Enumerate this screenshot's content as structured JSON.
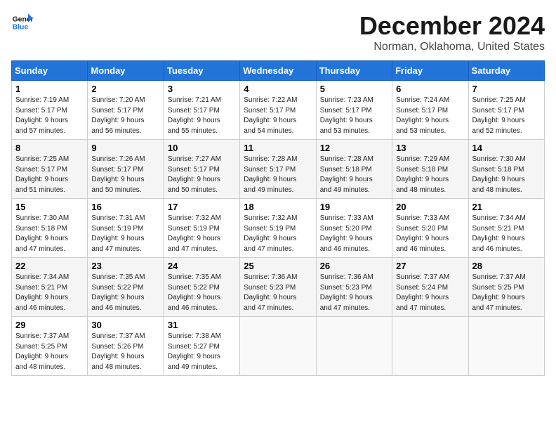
{
  "header": {
    "logo_line1": "General",
    "logo_line2": "Blue",
    "title": "December 2024",
    "subtitle": "Norman, Oklahoma, United States"
  },
  "days_of_week": [
    "Sunday",
    "Monday",
    "Tuesday",
    "Wednesday",
    "Thursday",
    "Friday",
    "Saturday"
  ],
  "weeks": [
    [
      {
        "day": 1,
        "sunrise": "7:19 AM",
        "sunset": "5:17 PM",
        "daylight": "9 hours and 57 minutes."
      },
      {
        "day": 2,
        "sunrise": "7:20 AM",
        "sunset": "5:17 PM",
        "daylight": "9 hours and 56 minutes."
      },
      {
        "day": 3,
        "sunrise": "7:21 AM",
        "sunset": "5:17 PM",
        "daylight": "9 hours and 55 minutes."
      },
      {
        "day": 4,
        "sunrise": "7:22 AM",
        "sunset": "5:17 PM",
        "daylight": "9 hours and 54 minutes."
      },
      {
        "day": 5,
        "sunrise": "7:23 AM",
        "sunset": "5:17 PM",
        "daylight": "9 hours and 53 minutes."
      },
      {
        "day": 6,
        "sunrise": "7:24 AM",
        "sunset": "5:17 PM",
        "daylight": "9 hours and 53 minutes."
      },
      {
        "day": 7,
        "sunrise": "7:25 AM",
        "sunset": "5:17 PM",
        "daylight": "9 hours and 52 minutes."
      }
    ],
    [
      {
        "day": 8,
        "sunrise": "7:25 AM",
        "sunset": "5:17 PM",
        "daylight": "9 hours and 51 minutes."
      },
      {
        "day": 9,
        "sunrise": "7:26 AM",
        "sunset": "5:17 PM",
        "daylight": "9 hours and 50 minutes."
      },
      {
        "day": 10,
        "sunrise": "7:27 AM",
        "sunset": "5:17 PM",
        "daylight": "9 hours and 50 minutes."
      },
      {
        "day": 11,
        "sunrise": "7:28 AM",
        "sunset": "5:17 PM",
        "daylight": "9 hours and 49 minutes."
      },
      {
        "day": 12,
        "sunrise": "7:28 AM",
        "sunset": "5:18 PM",
        "daylight": "9 hours and 49 minutes."
      },
      {
        "day": 13,
        "sunrise": "7:29 AM",
        "sunset": "5:18 PM",
        "daylight": "9 hours and 48 minutes."
      },
      {
        "day": 14,
        "sunrise": "7:30 AM",
        "sunset": "5:18 PM",
        "daylight": "9 hours and 48 minutes."
      }
    ],
    [
      {
        "day": 15,
        "sunrise": "7:30 AM",
        "sunset": "5:18 PM",
        "daylight": "9 hours and 47 minutes."
      },
      {
        "day": 16,
        "sunrise": "7:31 AM",
        "sunset": "5:19 PM",
        "daylight": "9 hours and 47 minutes."
      },
      {
        "day": 17,
        "sunrise": "7:32 AM",
        "sunset": "5:19 PM",
        "daylight": "9 hours and 47 minutes."
      },
      {
        "day": 18,
        "sunrise": "7:32 AM",
        "sunset": "5:19 PM",
        "daylight": "9 hours and 47 minutes."
      },
      {
        "day": 19,
        "sunrise": "7:33 AM",
        "sunset": "5:20 PM",
        "daylight": "9 hours and 46 minutes."
      },
      {
        "day": 20,
        "sunrise": "7:33 AM",
        "sunset": "5:20 PM",
        "daylight": "9 hours and 46 minutes."
      },
      {
        "day": 21,
        "sunrise": "7:34 AM",
        "sunset": "5:21 PM",
        "daylight": "9 hours and 46 minutes."
      }
    ],
    [
      {
        "day": 22,
        "sunrise": "7:34 AM",
        "sunset": "5:21 PM",
        "daylight": "9 hours and 46 minutes."
      },
      {
        "day": 23,
        "sunrise": "7:35 AM",
        "sunset": "5:22 PM",
        "daylight": "9 hours and 46 minutes."
      },
      {
        "day": 24,
        "sunrise": "7:35 AM",
        "sunset": "5:22 PM",
        "daylight": "9 hours and 46 minutes."
      },
      {
        "day": 25,
        "sunrise": "7:36 AM",
        "sunset": "5:23 PM",
        "daylight": "9 hours and 47 minutes."
      },
      {
        "day": 26,
        "sunrise": "7:36 AM",
        "sunset": "5:23 PM",
        "daylight": "9 hours and 47 minutes."
      },
      {
        "day": 27,
        "sunrise": "7:37 AM",
        "sunset": "5:24 PM",
        "daylight": "9 hours and 47 minutes."
      },
      {
        "day": 28,
        "sunrise": "7:37 AM",
        "sunset": "5:25 PM",
        "daylight": "9 hours and 47 minutes."
      }
    ],
    [
      {
        "day": 29,
        "sunrise": "7:37 AM",
        "sunset": "5:25 PM",
        "daylight": "9 hours and 48 minutes."
      },
      {
        "day": 30,
        "sunrise": "7:37 AM",
        "sunset": "5:26 PM",
        "daylight": "9 hours and 48 minutes."
      },
      {
        "day": 31,
        "sunrise": "7:38 AM",
        "sunset": "5:27 PM",
        "daylight": "9 hours and 49 minutes."
      },
      null,
      null,
      null,
      null
    ]
  ]
}
